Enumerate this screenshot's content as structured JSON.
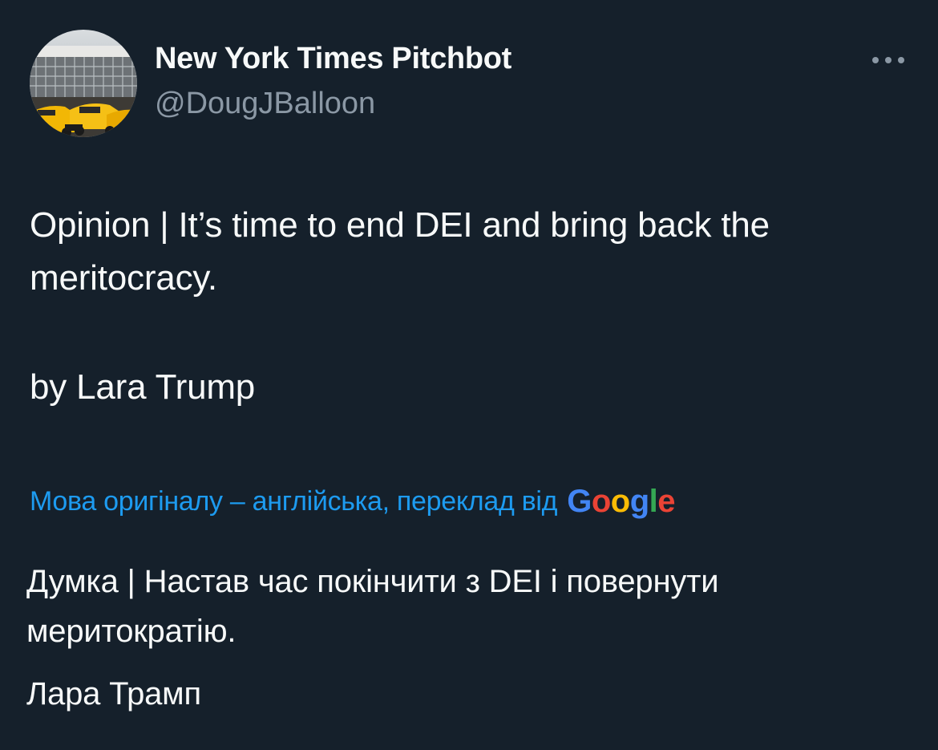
{
  "author": {
    "display_name": "New York Times Pitchbot",
    "handle": "@DougJBalloon",
    "avatar_icon": "nyt-building-avatar"
  },
  "menu": {
    "icon": "more-horizontal-icon"
  },
  "tweet": {
    "text": "Opinion | It’s time to end DEI and bring back the meritocracy.",
    "byline": "by Lara Trump"
  },
  "translation": {
    "label": "Мова оригіналу – англійська, переклад від",
    "provider": {
      "letters": [
        "G",
        "o",
        "o",
        "g",
        "l",
        "e"
      ]
    },
    "text": "Думка | Настав час покінчити з DEI і повернути меритократію.",
    "byline": "Лара Трамп"
  },
  "colors": {
    "background": "#15202b",
    "primary_text": "#f7f9f9",
    "secondary_text": "#8b98a5",
    "link": "#1d9bf0",
    "google_blue": "#4285f4",
    "google_red": "#ea4335",
    "google_yellow": "#fbbc05",
    "google_green": "#34a853"
  }
}
